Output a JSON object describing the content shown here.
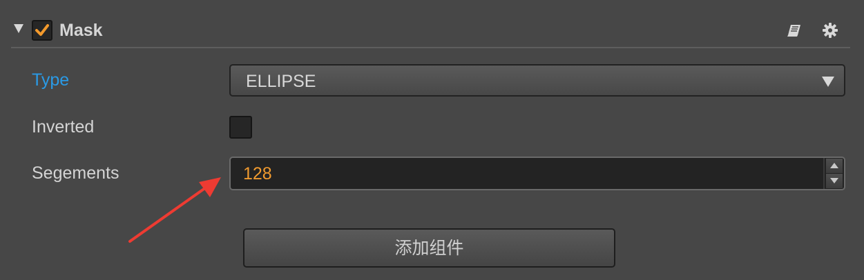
{
  "component": {
    "title": "Mask",
    "enabled": true
  },
  "properties": {
    "type": {
      "label": "Type",
      "value": "ELLIPSE"
    },
    "inverted": {
      "label": "Inverted",
      "checked": false
    },
    "segments": {
      "label": "Segements",
      "value": "128"
    }
  },
  "add_component_button": {
    "label": "添加组件"
  },
  "icons": {
    "collapse": "chevron-down-icon",
    "enabled_checkbox": "checkmark-icon",
    "documentation": "book-icon",
    "settings": "gear-icon",
    "type_dropdown": "caret-down-icon",
    "annotation": "red-arrow-icon"
  },
  "colors": {
    "background": "#474747",
    "active_label": "#2a9ae6",
    "checkmark": "#f39a2c",
    "number_value": "#f09a2f",
    "annotation_arrow": "#ee3b32"
  }
}
